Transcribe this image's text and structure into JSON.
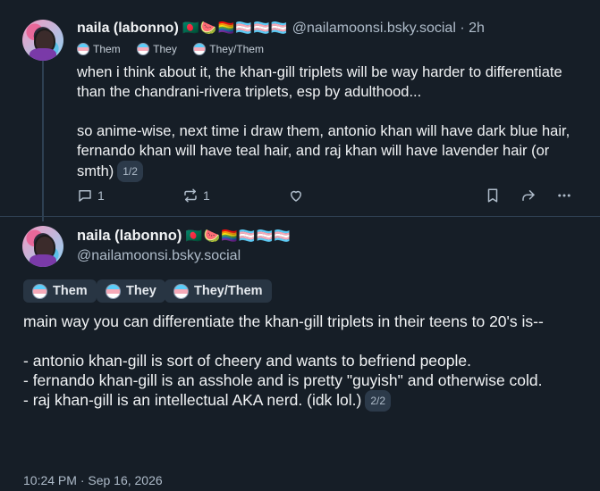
{
  "reply": {
    "author_name": "naila (labonno)",
    "author_flags": "🇧🇩🍉🏳️‍🌈🏳️‍⚧️🏳️‍⚧️🏳️‍⚧️",
    "handle": "@nailamoonsi.bsky.social",
    "time": "· 2h",
    "pronouns": [
      "Them",
      "They",
      "They/Them"
    ],
    "text_p1": "when i think about it, the khan-gill triplets will be way harder to differentiate than the chandrani-rivera triplets, esp by adulthood...",
    "text_p2": "so anime-wise, next time i draw them, antonio khan will have dark blue hair, fernando khan will have teal hair, and raj khan will have lavender hair (or smth)",
    "badge": "1/2",
    "reply_count": "1",
    "repost_count": "1"
  },
  "main_post": {
    "author_name": "naila (labonno)",
    "author_flags": "🇧🇩🍉🏳️‍🌈🏳️‍⚧️🏳️‍⚧️🏳️‍⚧️",
    "handle": "@nailamoonsi.bsky.social",
    "pronouns": [
      "Them",
      "They",
      "They/Them"
    ],
    "text": "main way you can differentiate the khan-gill triplets in their teens to 20's is--\n\n- antonio khan-gill is sort of cheery and wants to befriend people.\n- fernando khan-gill is an asshole and is pretty \"guyish\" and otherwise cold.\n- raj khan-gill is an intellectual AKA nerd. (idk lol.)",
    "badge": "2/2",
    "timestamp": "10:24 PM · Sep 16, 2026"
  },
  "icons": [
    "reply-icon",
    "repost-icon",
    "like-icon",
    "bookmark-icon",
    "share-icon",
    "more-icon"
  ],
  "colors": {
    "background": "#161e27",
    "text": "#f1f3f5",
    "muted": "#aebbc9",
    "chip_bg": "#283543"
  }
}
